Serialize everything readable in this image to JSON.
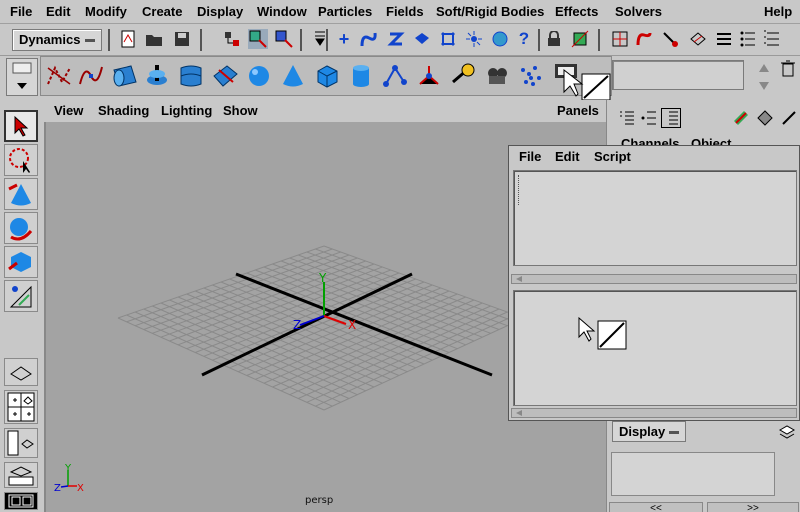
{
  "menubar": {
    "items": [
      "File",
      "Edit",
      "Modify",
      "Create",
      "Display",
      "Window",
      "Particles",
      "Fields",
      "Soft/Rigid Bodies",
      "Effects",
      "Solvers"
    ],
    "help": "Help"
  },
  "toolbar": {
    "menuset": "Dynamics",
    "icons": [
      "new-scene-icon",
      "open-scene-icon",
      "save-scene-icon",
      "select-by-hierarchy-icon",
      "select-by-object-icon",
      "select-by-component-icon",
      "snap-to-grid-icon",
      "snap-to-curve-icon",
      "snap-to-point-icon",
      "snap-to-plane-icon",
      "make-live-icon",
      "history-icon",
      "render-icon",
      "ipr-render-icon",
      "help-icon",
      "lock-icon",
      "input-ops-icon",
      "output-ops-icon"
    ]
  },
  "shelf": {
    "icons": [
      "curve-tool-icon",
      "ep-curve-icon",
      "extrude-icon",
      "revolve-icon",
      "loft-icon",
      "planar-icon",
      "sphere-icon",
      "cone-icon",
      "cube-icon",
      "cylinder-icon",
      "joint-tool-icon",
      "ik-handle-icon",
      "light-icon",
      "camera-icon",
      "particle-icon",
      "drag-cursor-icon"
    ]
  },
  "panel": {
    "menus": [
      "View",
      "Shading",
      "Lighting",
      "Show"
    ],
    "panels": "Panels",
    "camera": "persp"
  },
  "channel_box": {
    "tabs": [
      "Channels",
      "Object"
    ],
    "display": "Display",
    "buttons": [
      "<<",
      ">>"
    ]
  },
  "script_editor": {
    "menus": [
      "File",
      "Edit",
      "Script"
    ]
  },
  "axes": {
    "x": "X",
    "y": "Y",
    "z": "Z"
  },
  "colors": {
    "x_axis": "#e00000",
    "y_axis": "#00a000",
    "z_axis": "#0000d0",
    "viewport": "#a3a3a3"
  }
}
